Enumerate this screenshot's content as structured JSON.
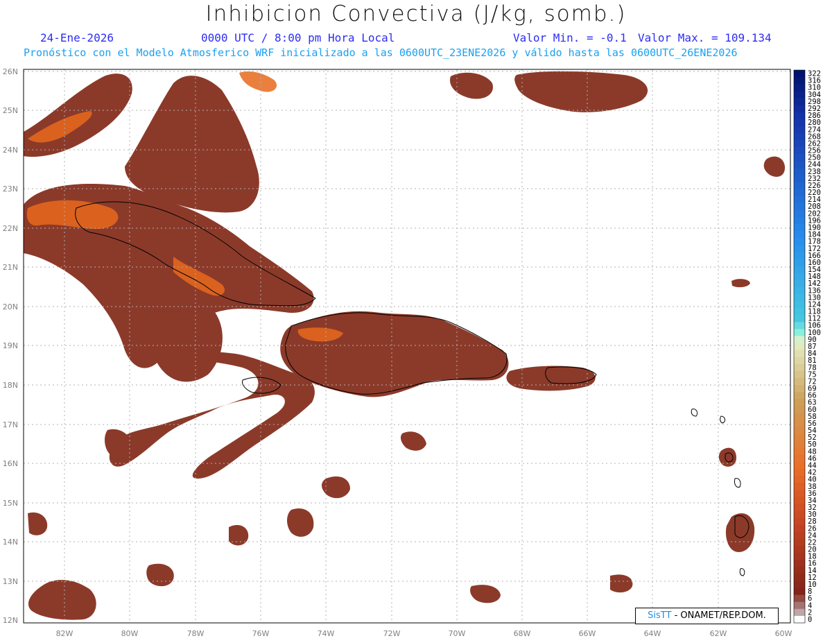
{
  "header": {
    "title": "Inhibicion Convectiva (J/kg, somb.)",
    "date": "24-Ene-2026",
    "time": "0000 UTC / 8:00 pm Hora Local",
    "valmin": "Valor Min. = -0.1",
    "valmax": "Valor Max. = 109.134",
    "subtitle": "Pronóstico con el Modelo Atmosferico WRF inicializado a las 0600UTC_23ENE2026 y válido hasta las  0600UTC_26ENE2026"
  },
  "map": {
    "lat_labels": [
      "26N",
      "25N",
      "24N",
      "23N",
      "22N",
      "21N",
      "20N",
      "19N",
      "18N",
      "17N",
      "16N",
      "15N",
      "14N",
      "13N",
      "12N"
    ],
    "lon_labels": [
      "82W",
      "80W",
      "78W",
      "76W",
      "74W",
      "72W",
      "70W",
      "68W",
      "66W",
      "64W",
      "62W",
      "60W"
    ],
    "field_color": "#8b3a2a",
    "highlight_color": "#e86a1c"
  },
  "colorbar": {
    "labels": [
      "322",
      "316",
      "310",
      "304",
      "298",
      "292",
      "286",
      "280",
      "274",
      "268",
      "262",
      "256",
      "250",
      "244",
      "238",
      "232",
      "226",
      "220",
      "214",
      "208",
      "202",
      "196",
      "190",
      "184",
      "178",
      "172",
      "166",
      "160",
      "154",
      "148",
      "142",
      "136",
      "130",
      "124",
      "118",
      "112",
      "106",
      "100",
      "90",
      "87",
      "84",
      "81",
      "78",
      "75",
      "72",
      "69",
      "66",
      "63",
      "60",
      "58",
      "56",
      "54",
      "52",
      "50",
      "48",
      "46",
      "44",
      "42",
      "40",
      "38",
      "36",
      "34",
      "32",
      "30",
      "28",
      "26",
      "24",
      "22",
      "20",
      "18",
      "16",
      "14",
      "12",
      "10",
      "8",
      "6",
      "4",
      "2",
      "0"
    ]
  },
  "credit": {
    "brand": "SisTT",
    "text": " - ONAMET/REP.DOM."
  }
}
